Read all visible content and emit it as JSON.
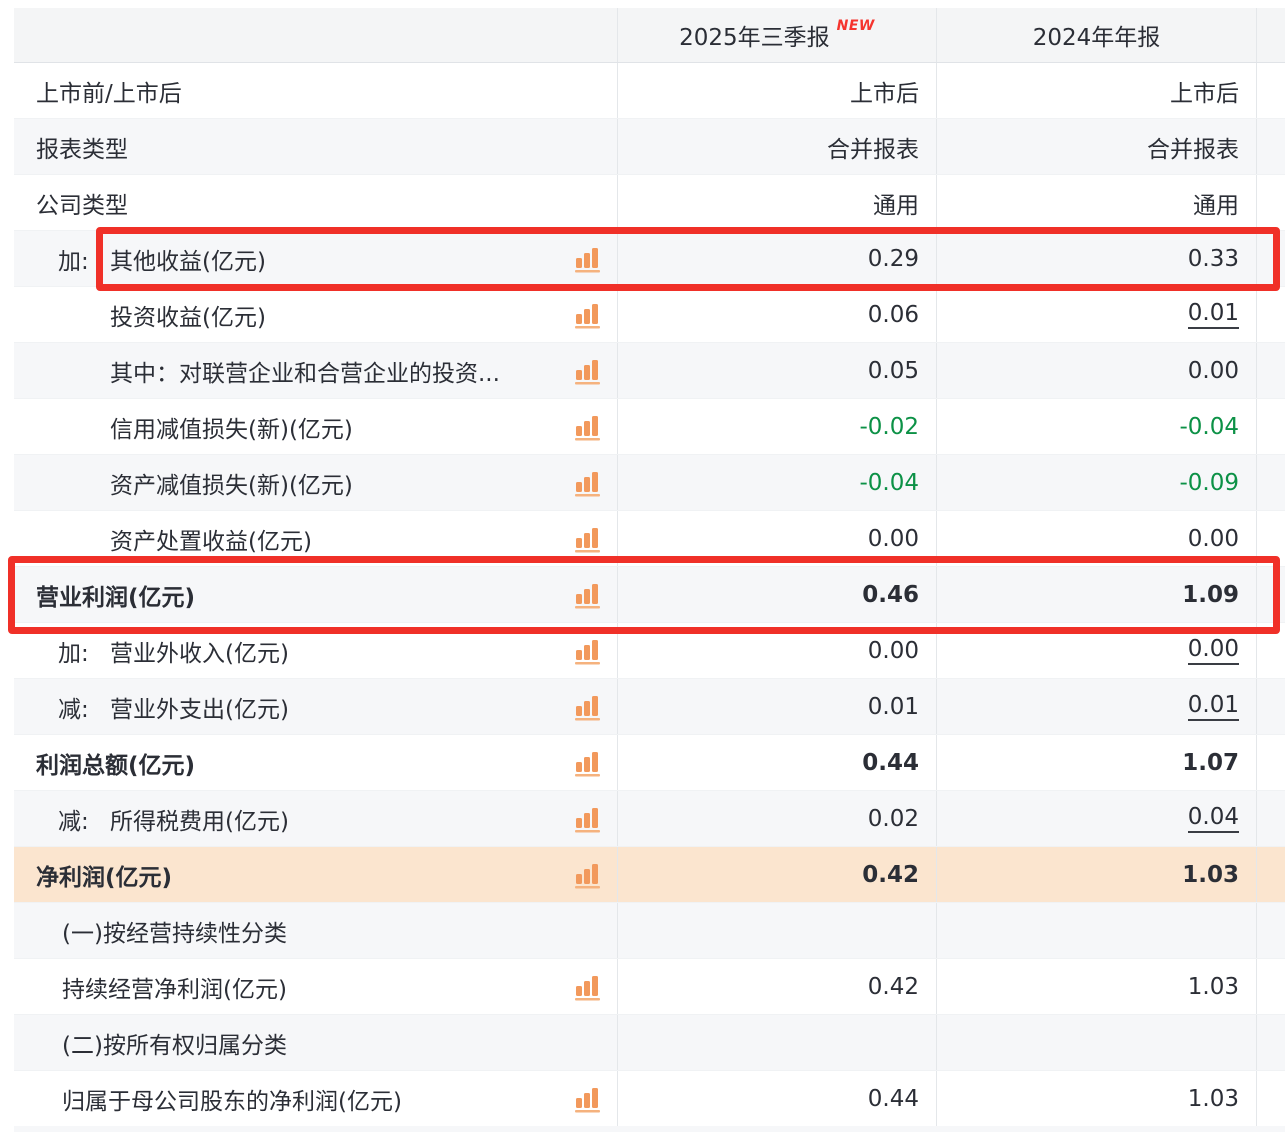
{
  "header": {
    "period_1": "2025年三季报",
    "new_badge": "NEW",
    "period_2": "2024年年报"
  },
  "table": {
    "rows": [
      {
        "label": "上市前/上市后",
        "indent": "top",
        "icon": false,
        "bold": false,
        "stripe": false,
        "highlight": false,
        "values": [
          "上市后",
          "上市后"
        ],
        "styles": [
          "",
          ""
        ]
      },
      {
        "label": "报表类型",
        "indent": "top",
        "icon": false,
        "bold": false,
        "stripe": true,
        "highlight": false,
        "values": [
          "合并报表",
          "合并报表"
        ],
        "styles": [
          "",
          ""
        ]
      },
      {
        "label": "公司类型",
        "indent": "top",
        "icon": false,
        "bold": false,
        "stripe": false,
        "highlight": false,
        "values": [
          "通用",
          "通用"
        ],
        "styles": [
          "",
          ""
        ]
      },
      {
        "prefix": "加:",
        "label": "其他收益(亿元)",
        "indent": "prefix",
        "icon": true,
        "bold": false,
        "stripe": true,
        "highlight": false,
        "values": [
          "0.29",
          "0.33"
        ],
        "styles": [
          "",
          ""
        ]
      },
      {
        "label": "投资收益(亿元)",
        "indent": "sub",
        "icon": true,
        "bold": false,
        "stripe": false,
        "highlight": false,
        "values": [
          "0.06",
          "0.01"
        ],
        "styles": [
          "",
          "underline"
        ]
      },
      {
        "label": "其中：对联营企业和合营企业的投资...",
        "indent": "sub",
        "icon": true,
        "bold": false,
        "stripe": true,
        "highlight": false,
        "values": [
          "0.05",
          "0.00"
        ],
        "styles": [
          "",
          ""
        ]
      },
      {
        "label": "信用减值损失(新)(亿元)",
        "indent": "sub",
        "icon": true,
        "bold": false,
        "stripe": false,
        "highlight": false,
        "values": [
          "-0.02",
          "-0.04"
        ],
        "styles": [
          "green",
          "green"
        ]
      },
      {
        "label": "资产减值损失(新)(亿元)",
        "indent": "sub",
        "icon": true,
        "bold": false,
        "stripe": true,
        "highlight": false,
        "values": [
          "-0.04",
          "-0.09"
        ],
        "styles": [
          "green",
          "green"
        ]
      },
      {
        "label": "资产处置收益(亿元)",
        "indent": "sub",
        "icon": true,
        "bold": false,
        "stripe": false,
        "highlight": false,
        "values": [
          "0.00",
          "0.00"
        ],
        "styles": [
          "",
          ""
        ]
      },
      {
        "label": "营业利润(亿元)",
        "indent": "top",
        "icon": true,
        "bold": true,
        "stripe": true,
        "highlight": false,
        "values": [
          "0.46",
          "1.09"
        ],
        "styles": [
          "",
          ""
        ]
      },
      {
        "prefix": "加:",
        "label": "营业外收入(亿元)",
        "indent": "prefix",
        "icon": true,
        "bold": false,
        "stripe": false,
        "highlight": false,
        "values": [
          "0.00",
          "0.00"
        ],
        "styles": [
          "",
          "underline"
        ]
      },
      {
        "prefix": "减:",
        "label": "营业外支出(亿元)",
        "indent": "prefix",
        "icon": true,
        "bold": false,
        "stripe": true,
        "highlight": false,
        "values": [
          "0.01",
          "0.01"
        ],
        "styles": [
          "",
          "underline"
        ]
      },
      {
        "label": "利润总额(亿元)",
        "indent": "top",
        "icon": true,
        "bold": true,
        "stripe": false,
        "highlight": false,
        "values": [
          "0.44",
          "1.07"
        ],
        "styles": [
          "",
          ""
        ]
      },
      {
        "prefix": "减:",
        "label": "所得税费用(亿元)",
        "indent": "prefix",
        "icon": true,
        "bold": false,
        "stripe": true,
        "highlight": false,
        "values": [
          "0.02",
          "0.04"
        ],
        "styles": [
          "",
          "underline"
        ]
      },
      {
        "label": "净利润(亿元)",
        "indent": "top",
        "icon": true,
        "bold": true,
        "stripe": false,
        "highlight": true,
        "values": [
          "0.42",
          "1.03"
        ],
        "styles": [
          "",
          ""
        ]
      },
      {
        "label": "(一)按经营持续性分类",
        "indent": "mid",
        "icon": false,
        "bold": false,
        "stripe": true,
        "highlight": false,
        "values": [
          "",
          ""
        ],
        "styles": [
          "",
          ""
        ]
      },
      {
        "label": "持续经营净利润(亿元)",
        "indent": "mid",
        "icon": true,
        "bold": false,
        "stripe": false,
        "highlight": false,
        "values": [
          "0.42",
          "1.03"
        ],
        "styles": [
          "",
          ""
        ]
      },
      {
        "label": "(二)按所有权归属分类",
        "indent": "mid",
        "icon": false,
        "bold": false,
        "stripe": true,
        "highlight": false,
        "values": [
          "",
          ""
        ],
        "styles": [
          "",
          ""
        ]
      },
      {
        "label": "归属于母公司股东的净利润(亿元)",
        "indent": "mid",
        "icon": true,
        "bold": false,
        "stripe": false,
        "highlight": false,
        "values": [
          "0.44",
          "1.03"
        ],
        "styles": [
          "",
          ""
        ]
      }
    ]
  },
  "annotations": {
    "red_box_1_target": "其他收益(亿元)",
    "red_box_2_target": "营业利润(亿元)"
  },
  "colors": {
    "annotation_red": "#f03028",
    "new_badge_red": "#f5342e",
    "negative_green": "#0c9146",
    "chart_icon_orange": "#f2995c",
    "highlight_row_bg": "#fbe5cf",
    "header_bg": "#f4f5f6",
    "stripe_bg": "#f6f7f9",
    "text": "#2b2e36"
  }
}
